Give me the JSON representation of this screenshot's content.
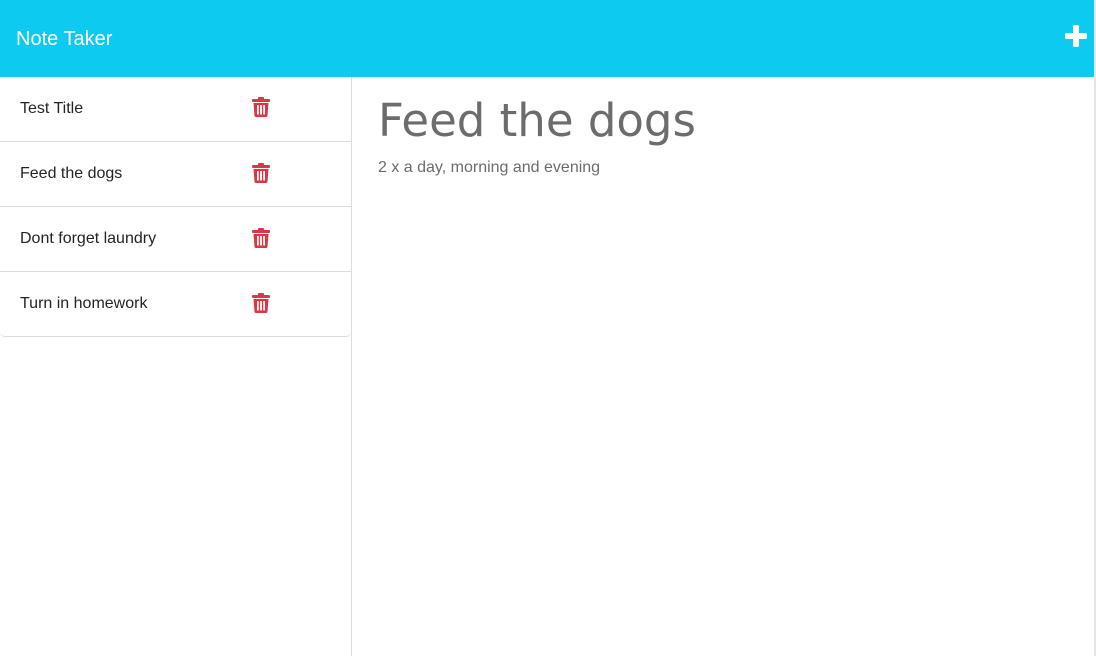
{
  "app": {
    "title": "Note Taker"
  },
  "colors": {
    "navbar": "#0dcaf0",
    "delete_icon": "#dc3545",
    "note_text": "#6c6c6c"
  },
  "icons": {
    "new_note": "plus-icon",
    "delete": "trash-icon"
  },
  "notes": [
    {
      "title": "Test Title"
    },
    {
      "title": "Feed the dogs"
    },
    {
      "title": "Dont forget laundry"
    },
    {
      "title": "Turn in homework"
    }
  ],
  "active_note": {
    "title": "Feed the dogs",
    "text": "2 x a day, morning and evening"
  }
}
